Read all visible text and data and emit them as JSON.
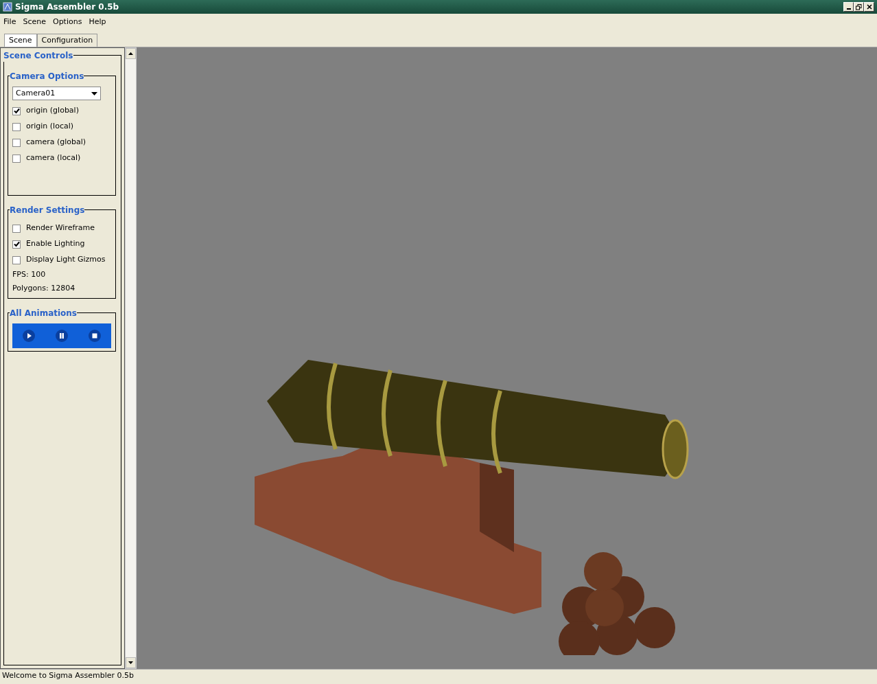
{
  "window": {
    "title": "Sigma Assembler 0.5b"
  },
  "menu": [
    "File",
    "Scene",
    "Options",
    "Help"
  ],
  "tabs": [
    {
      "label": "Scene",
      "selected": true
    },
    {
      "label": "Configuration",
      "selected": false
    }
  ],
  "panel": {
    "title": "Scene Controls",
    "groups": [
      {
        "title": "Camera Options",
        "items": [
          {
            "kind": "dropdown",
            "value": "Camera01"
          },
          {
            "kind": "checkbox",
            "label": "origin (global)",
            "checked": true
          },
          {
            "kind": "checkbox",
            "label": "origin (local)",
            "checked": false
          },
          {
            "kind": "checkbox",
            "label": "camera (global)",
            "checked": false
          },
          {
            "kind": "checkbox",
            "label": "camera (local)",
            "checked": false
          }
        ]
      },
      {
        "title": "Render Settings",
        "items": [
          {
            "kind": "checkbox",
            "label": "Render Wireframe",
            "checked": false
          },
          {
            "kind": "checkbox",
            "label": "Enable Lighting",
            "checked": true
          },
          {
            "kind": "checkbox",
            "label": "Display Light Gizmos",
            "checked": false
          },
          {
            "kind": "text",
            "label": "FPS: 100"
          },
          {
            "kind": "text",
            "label": "Polygons: 12804"
          }
        ]
      },
      {
        "title": "All Animations",
        "items": [
          {
            "kind": "media"
          }
        ]
      }
    ]
  },
  "status_bar": "Welcome to Sigma Assembler 0.5b"
}
